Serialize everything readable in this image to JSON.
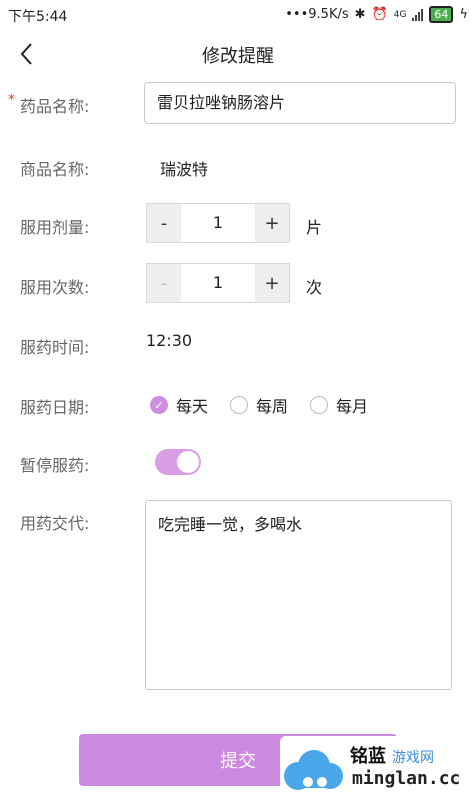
{
  "status": {
    "time": "下午5:44",
    "speed": "•••9.5K/s",
    "network": "4G",
    "battery": "64"
  },
  "nav": {
    "title": "修改提醒"
  },
  "form": {
    "drug_name": {
      "label": "药品名称:",
      "value": "雷贝拉唑钠肠溶片"
    },
    "brand_name": {
      "label": "商品名称:",
      "value": "瑞波特"
    },
    "dose": {
      "label": "服用剂量:",
      "minus": "-",
      "plus": "+",
      "value": "1",
      "unit": "片"
    },
    "times": {
      "label": "服用次数:",
      "minus": "-",
      "plus": "+",
      "value": "1",
      "unit": "次"
    },
    "time": {
      "label": "服药时间:",
      "value": "12:30"
    },
    "date": {
      "label": "服药日期:",
      "options": [
        "每天",
        "每周",
        "每月"
      ],
      "selected": "每天"
    },
    "pause": {
      "label": "暂停服药:",
      "on": true
    },
    "note": {
      "label": "用药交代:",
      "value": "吃完睡一觉，多喝水"
    }
  },
  "submit_label": "提交",
  "watermark": {
    "title": "铭蓝",
    "subtitle": "游戏网",
    "url": "minglan.cc"
  },
  "colors": {
    "accent": "#cc89e0",
    "required": "#e53935"
  }
}
